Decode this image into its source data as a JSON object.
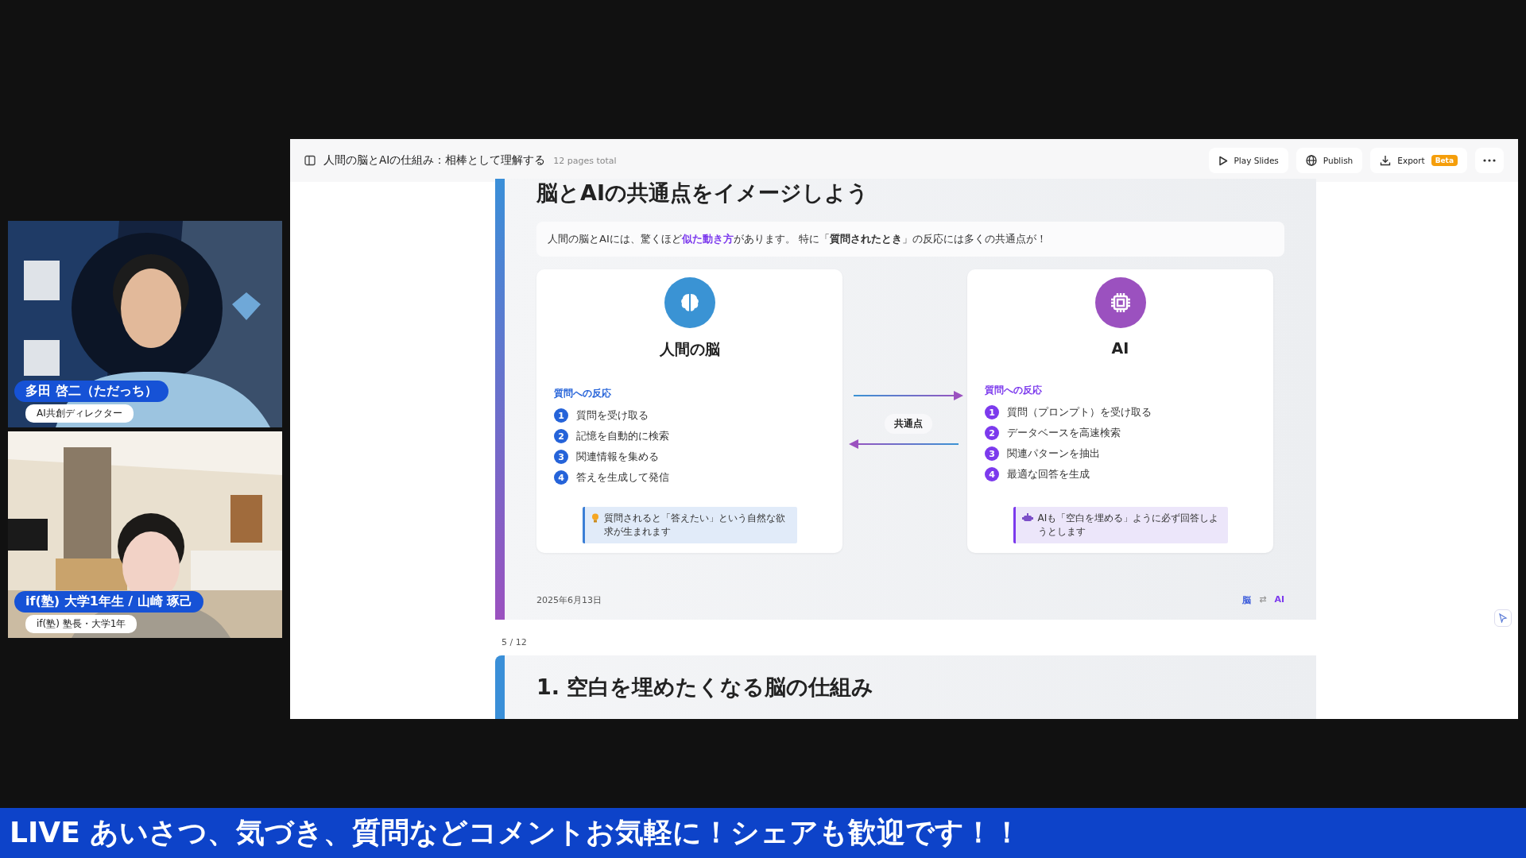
{
  "document_bar": {
    "title": "人間の脳とAIの仕組み：相棒として理解する",
    "page_count": "12 pages total",
    "actions": [
      {
        "kind": "play",
        "label": "Play Slides"
      },
      {
        "kind": "publish",
        "label": "Publish"
      },
      {
        "kind": "export",
        "label": "Export",
        "badge": "Beta"
      },
      {
        "kind": "more"
      }
    ]
  },
  "current_slide": {
    "title": "脳とAIの共通点をイメージしよう",
    "intro": "人間の脳とAIには、驚くほど**似た動き方**があります。 特に「**質問されたとき**」の反応には多くの共通点が！",
    "cards": [
      {
        "kind": "brain",
        "color": "#3a93d4",
        "title": "人間の脳",
        "section": "質問への反応",
        "steps": [
          {
            "number": "1",
            "text": "質問を受け取る"
          },
          {
            "number": "2",
            "text": "記憶を自動的に検索"
          },
          {
            "number": "3",
            "text": "関連情報を集める"
          },
          {
            "number": "4",
            "text": "答えを生成して発信"
          }
        ],
        "note": "質問されると「答えたい」という自然な欲求が生まれます"
      },
      {
        "kind": "chip",
        "color": "#9b51bf",
        "title": "AI",
        "section": "質問への反応",
        "steps": [
          {
            "number": "1",
            "text": "質問（プロンプト）を受け取る"
          },
          {
            "number": "2",
            "text": "データベースを高速検索"
          },
          {
            "number": "3",
            "text": "関連パターンを抽出"
          },
          {
            "number": "4",
            "text": "最適な回答を生成"
          }
        ],
        "note": "AIも「空白を埋める」ように必ず回答しようとします"
      }
    ],
    "connector": "共通点",
    "date": "2025年6月13日",
    "footer_tags": [
      "脳",
      "⇄",
      "AI"
    ]
  },
  "page_indicator": "5 / 12",
  "next_slide": {
    "title": "1. 空白を埋めたくなる脳の仕組み"
  },
  "participants": [
    {
      "kind": "picture",
      "name": "多田 啓二（ただっち）",
      "role": "AI共創ディレクター"
    },
    {
      "kind": "picture",
      "name": "if(塾) 大学1年生 / 山崎 琢己",
      "role": "if(塾) 塾長・大学1年"
    }
  ],
  "ticker": "LIVE あいさつ、気づき、質問などコメントお気軽に！シェアも歓迎です！！"
}
